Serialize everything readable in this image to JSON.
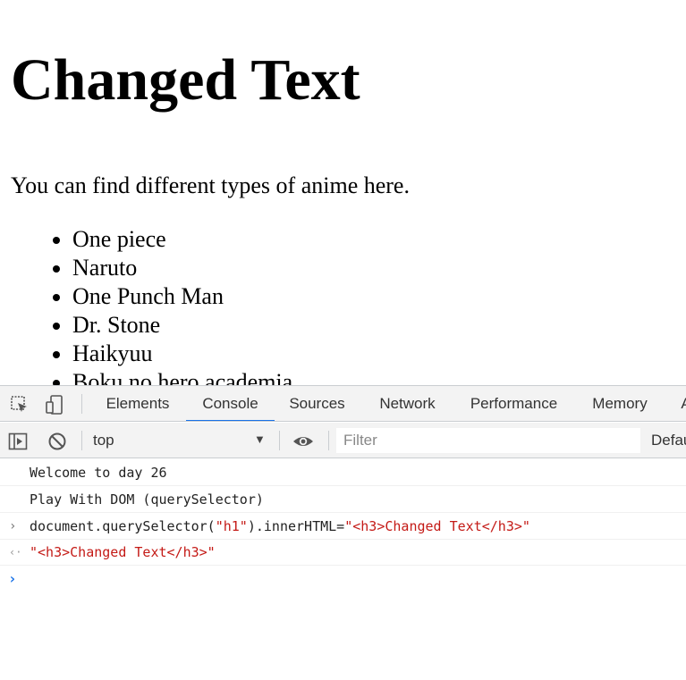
{
  "page": {
    "heading": "Changed Text",
    "paragraph": "You can find different types of anime here.",
    "anime_list": [
      "One piece",
      "Naruto",
      "One Punch Man",
      "Dr. Stone",
      "Haikyuu",
      "Boku no hero academia"
    ]
  },
  "devtools": {
    "tabs": [
      "Elements",
      "Console",
      "Sources",
      "Network",
      "Performance",
      "Memory",
      "A"
    ],
    "active_tab": "Console",
    "toolbar": {
      "context": "top",
      "filter_placeholder": "Filter",
      "levels_label": "Defau"
    },
    "console": {
      "log1": "Welcome to day 26",
      "log2": "Play With DOM (querySelector)",
      "cmd_prefix": "document.querySelector(",
      "cmd_arg": "\"h1\"",
      "cmd_middle": ").innerHTML=",
      "cmd_value": "\"<h3>Changed Text</h3>\"",
      "result": "\"<h3>Changed Text</h3>\"",
      "input_glyph": "›",
      "result_glyph": "‹·",
      "prompt_glyph": "›"
    },
    "colors": {
      "accent": "#1a73e8",
      "string": "#c41a16",
      "toolbar_bg": "#f3f3f3"
    }
  }
}
